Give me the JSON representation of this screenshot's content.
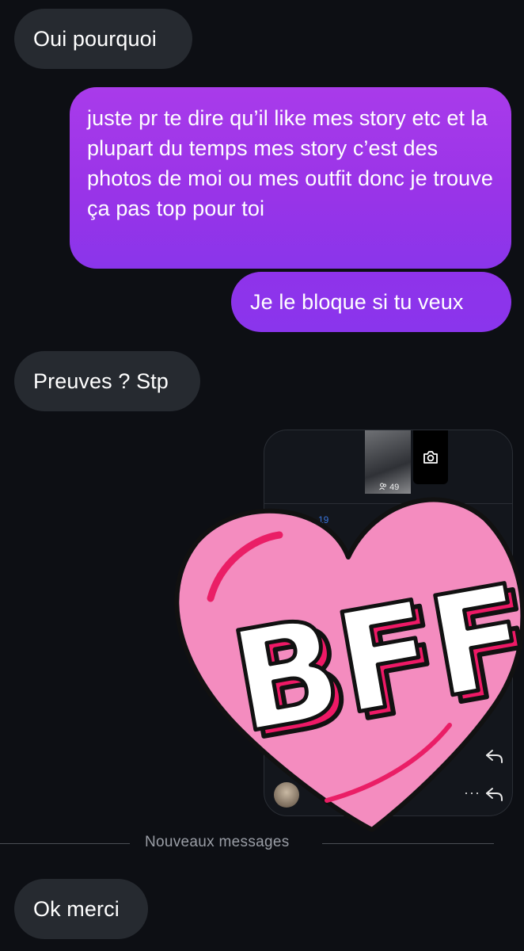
{
  "messages": {
    "m1": "Oui pourquoi",
    "m2": "juste pr te dire qu’il like mes story etc et la plupart du temps mes story c’est des photos de moi ou mes outfit donc je trouve ça pas top pour toi",
    "m3": "Je le bloque si tu veux",
    "m4": "Preuves ? Stp",
    "m6": "Ok merci"
  },
  "shared_screenshot": {
    "viewer_count": "49",
    "timestamp_fragment": "19",
    "icons": [
      "camera-icon",
      "people-icon",
      "reply-icon",
      "more-icon",
      "avatar"
    ]
  },
  "sticker": {
    "text": "BFF",
    "colors": {
      "heart": "#f48cbf",
      "heart_border": "#111111",
      "letters": "#ffffff",
      "letter_shadow": "#ee1966"
    }
  },
  "divider": {
    "label": "Nouveaux messages"
  },
  "colors": {
    "background": "#0d0f14",
    "incoming_bubble": "#262a30",
    "outgoing_gradient_top": "#a93bea",
    "outgoing_gradient_bottom": "#8a35ea"
  }
}
